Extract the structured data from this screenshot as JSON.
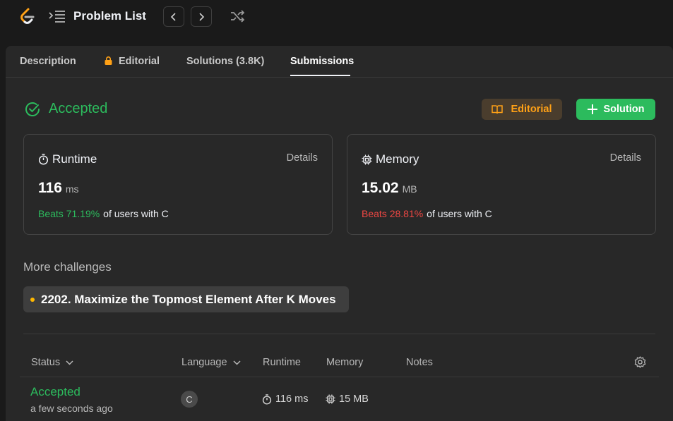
{
  "header": {
    "title": "Problem List",
    "icons": [
      "leetcode-logo",
      "list-icon",
      "chevron-left-icon",
      "chevron-right-icon",
      "shuffle-icon"
    ]
  },
  "tabs": [
    {
      "label": "Description"
    },
    {
      "label": "Editorial"
    },
    {
      "label": "Solutions (3.8K)"
    },
    {
      "label": "Submissions"
    }
  ],
  "result": {
    "status": "Accepted",
    "editorial_button": "Editorial",
    "solution_button": "Solution"
  },
  "runtime": {
    "title": "Runtime",
    "details": "Details",
    "value": "116",
    "unit": "ms",
    "beats": "Beats 71.19%",
    "suffix": "of users with C"
  },
  "memory": {
    "title": "Memory",
    "details": "Details",
    "value": "15.02",
    "unit": "MB",
    "beats": "Beats 28.81%",
    "suffix": "of users with C"
  },
  "challenges": {
    "heading": "More challenges",
    "items": [
      "2202. Maximize the Topmost Element After K Moves"
    ]
  },
  "table": {
    "headers": {
      "status": "Status",
      "language": "Language",
      "runtime": "Runtime",
      "memory": "Memory",
      "notes": "Notes"
    },
    "rows": [
      {
        "status": "Accepted",
        "time": "a few seconds ago",
        "language": "C",
        "runtime": "116 ms",
        "memory": "15 MB"
      }
    ]
  },
  "colors": {
    "accent_green": "#2cbb5d",
    "accent_orange": "#ffa116",
    "accent_red": "#ef4743"
  }
}
